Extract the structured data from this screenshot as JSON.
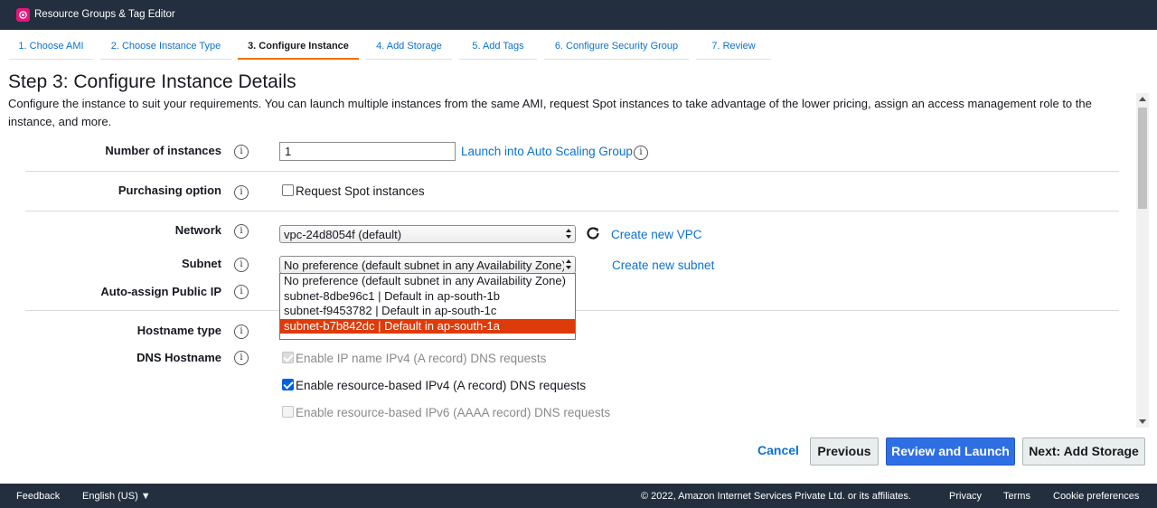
{
  "topbar": {
    "service_name": "Resource Groups & Tag Editor",
    "logo_icon": "resource-groups-icon",
    "logo_color": "#e7157b"
  },
  "wizard": {
    "tabs": [
      {
        "label": "1. Choose AMI",
        "active": false
      },
      {
        "label": "2. Choose Instance Type",
        "active": false
      },
      {
        "label": "3. Configure Instance",
        "active": true
      },
      {
        "label": "4. Add Storage",
        "active": false
      },
      {
        "label": "5. Add Tags",
        "active": false
      },
      {
        "label": "6. Configure Security Group",
        "active": false
      },
      {
        "label": "7. Review",
        "active": false
      }
    ],
    "active_color": "#ec7211"
  },
  "page": {
    "title": "Step 3: Configure Instance Details",
    "description": "Configure the instance to suit your requirements. You can launch multiple instances from the same AMI, request Spot instances to take advantage of the lower pricing, assign an access management role to the instance, and more."
  },
  "form": {
    "info_glyph": "i",
    "number_of_instances": {
      "label": "Number of instances",
      "value": "1",
      "link": "Launch into Auto Scaling Group"
    },
    "purchasing_option": {
      "label": "Purchasing option",
      "checkbox_label": "Request Spot instances",
      "checked": false
    },
    "network": {
      "label": "Network",
      "selected": "vpc-24d8054f (default)",
      "link": "Create new VPC"
    },
    "subnet": {
      "label": "Subnet",
      "selected": "No preference (default subnet in any Availability Zone)",
      "link": "Create new subnet",
      "options": [
        {
          "label": "No preference (default subnet in any Availability Zone)",
          "highlighted": false
        },
        {
          "label": "subnet-8dbe96c1 | Default in ap-south-1b",
          "highlighted": false
        },
        {
          "label": "subnet-f9453782 | Default in ap-south-1c",
          "highlighted": false
        },
        {
          "label": "subnet-b7b842dc | Default in ap-south-1a",
          "highlighted": true
        }
      ],
      "highlight_color": "#df3a09"
    },
    "auto_assign_public_ip": {
      "label": "Auto-assign Public IP"
    },
    "hostname_type": {
      "label": "Hostname type"
    },
    "dns_hostname": {
      "label": "DNS Hostname",
      "options": [
        {
          "label": "Enable IP name IPv4 (A record) DNS requests",
          "checked": true,
          "disabled": true
        },
        {
          "label": "Enable resource-based IPv4 (A record) DNS requests",
          "checked": true,
          "disabled": false
        },
        {
          "label": "Enable resource-based IPv6 (AAAA record) DNS requests",
          "checked": false,
          "disabled": true
        }
      ]
    }
  },
  "actions": {
    "cancel": "Cancel",
    "previous": "Previous",
    "review_launch": "Review and Launch",
    "next": "Next: Add Storage",
    "primary_color": "#2f6fe4"
  },
  "footer": {
    "feedback": "Feedback",
    "language": "English (US) ▼",
    "copyright": "© 2022, Amazon Internet Services Private Ltd. or its affiliates.",
    "privacy": "Privacy",
    "terms": "Terms",
    "cookie": "Cookie preferences"
  }
}
